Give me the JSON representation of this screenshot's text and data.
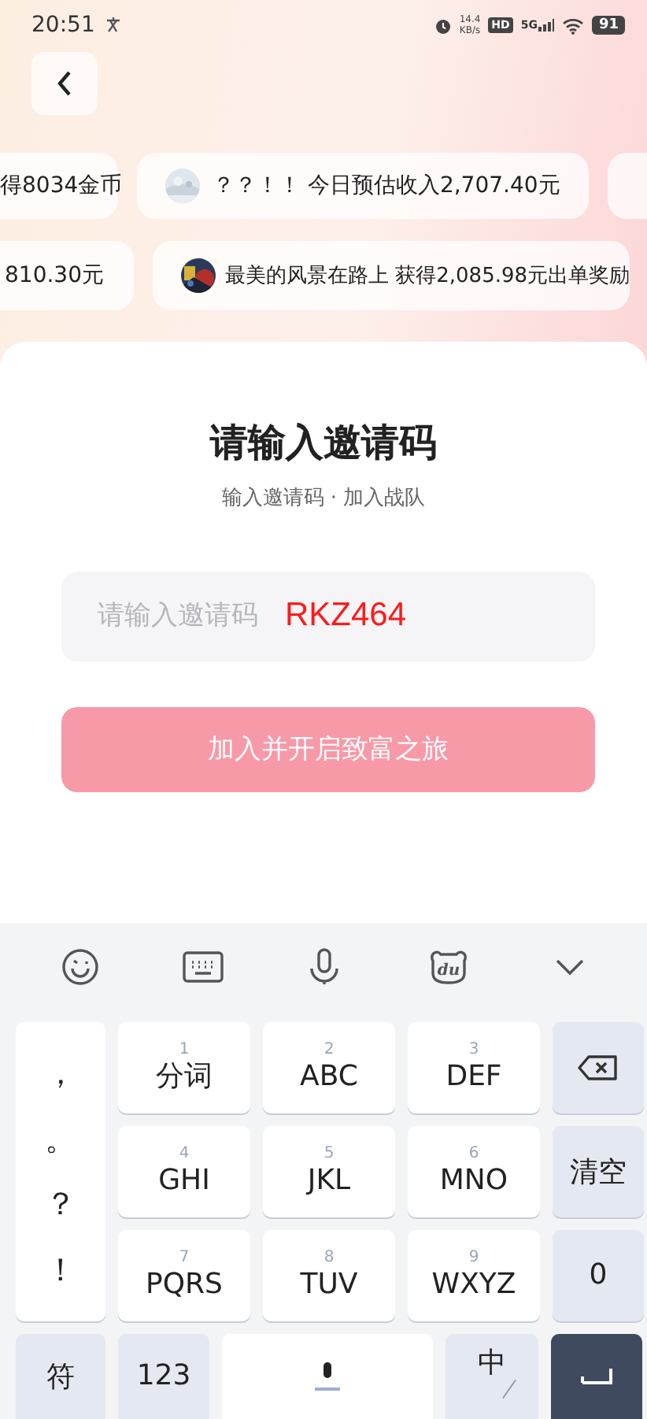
{
  "status_bar": {
    "time": "20:51",
    "net_speed": "14.4",
    "net_unit": "KB/s",
    "hd": "HD",
    "network": "5G",
    "battery": "91"
  },
  "tickers": [
    {
      "chips": [
        {
          "kind": "text",
          "text": "得8034金币"
        },
        {
          "kind": "avatar",
          "text": "？？！！ 今日预估收入2,707.40元"
        },
        {
          "kind": "blank"
        }
      ]
    },
    {
      "chips": [
        {
          "kind": "text",
          "text": "810.30元"
        },
        {
          "kind": "avatar",
          "text": "最美的风景在路上 获得2,085.98元出单奖励"
        }
      ]
    }
  ],
  "card": {
    "title": "请输入邀请码",
    "subtitle": "输入邀请码 · 加入战队",
    "field": {
      "placeholder": "请输入邀请码",
      "annotation": "RKZ464"
    },
    "button": "加入并开启致富之旅"
  },
  "keyboard": {
    "logo_text": "du",
    "punctuation": [
      "，",
      "。",
      "？",
      "！"
    ],
    "digit_keys": [
      {
        "digit": "1",
        "label": "分词"
      },
      {
        "digit": "2",
        "label": "ABC"
      },
      {
        "digit": "3",
        "label": "DEF"
      },
      {
        "digit": "4",
        "label": "GHI"
      },
      {
        "digit": "5",
        "label": "JKL"
      },
      {
        "digit": "6",
        "label": "MNO"
      },
      {
        "digit": "7",
        "label": "PQRS"
      },
      {
        "digit": "8",
        "label": "TUV"
      },
      {
        "digit": "9",
        "label": "WXYZ"
      }
    ],
    "clear_key": "清空",
    "zero_key": "0",
    "symbols_key": "符",
    "numbers_key": "123",
    "language_key": "中"
  }
}
